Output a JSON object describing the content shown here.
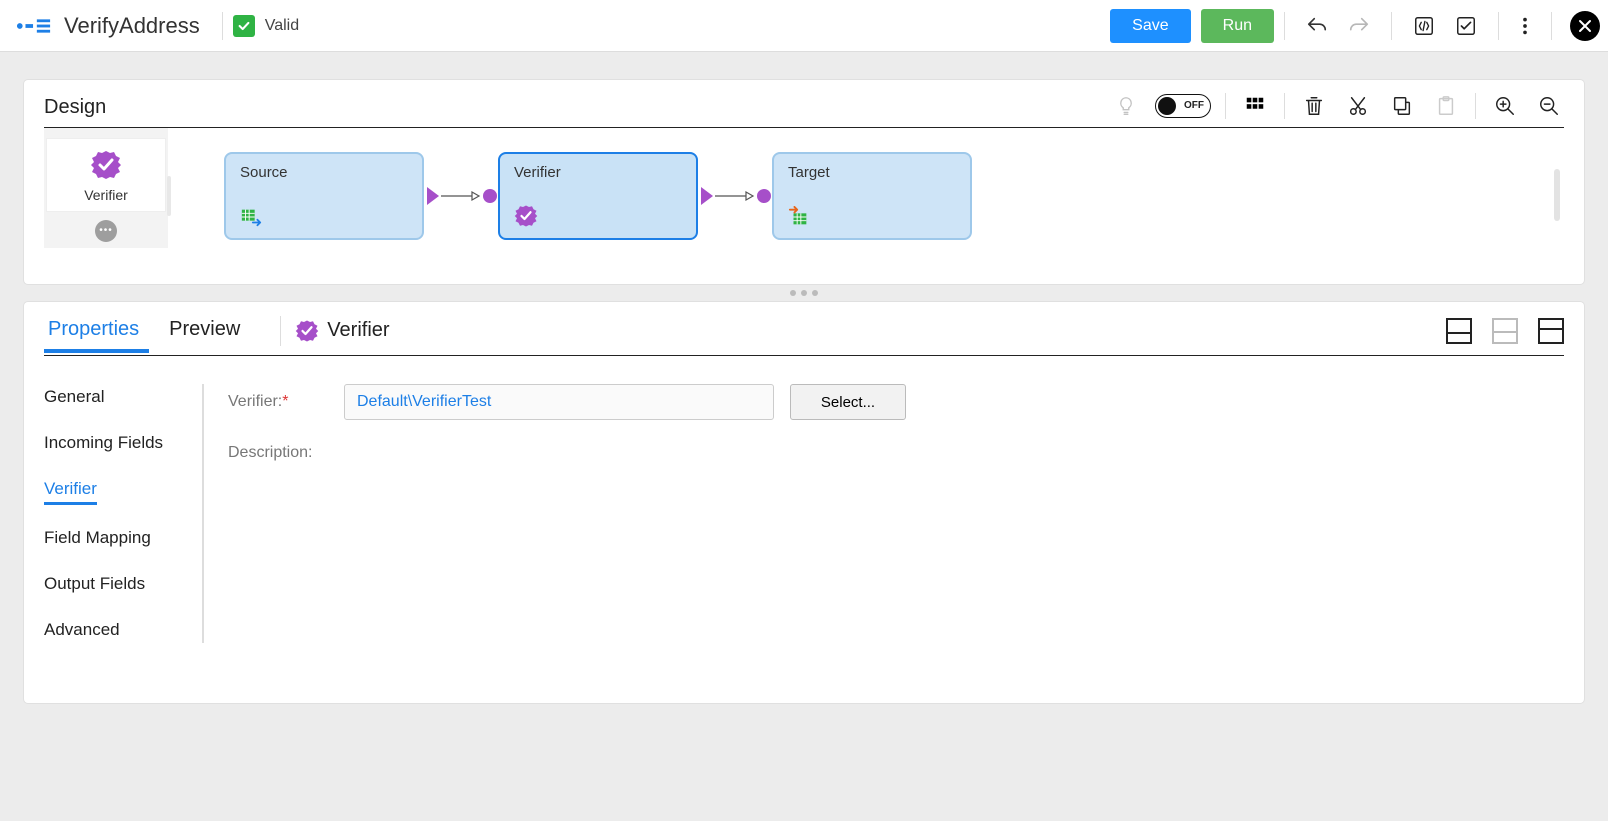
{
  "header": {
    "title": "VerifyAddress",
    "status_text": "Valid",
    "save_label": "Save",
    "run_label": "Run"
  },
  "design": {
    "title": "Design",
    "toggle_label": "OFF",
    "palette": {
      "item_label": "Verifier"
    },
    "nodes": {
      "source": "Source",
      "verifier": "Verifier",
      "target": "Target"
    }
  },
  "props": {
    "tabs": {
      "properties": "Properties",
      "preview": "Preview"
    },
    "crumb": "Verifier",
    "sidenav": {
      "general": "General",
      "incoming": "Incoming Fields",
      "verifier": "Verifier",
      "fieldmap": "Field Mapping",
      "output": "Output Fields",
      "advanced": "Advanced"
    },
    "form": {
      "verifier_label": "Verifier:",
      "verifier_value": "Default\\VerifierTest",
      "select_label": "Select...",
      "description_label": "Description:"
    }
  }
}
